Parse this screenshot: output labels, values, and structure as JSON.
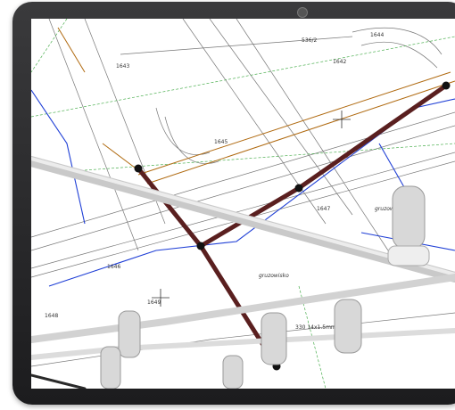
{
  "device": {
    "camera_icon": "webcam-dot-icon"
  },
  "map": {
    "parcel_labels": [
      "536/2",
      "1642",
      "1643",
      "1644",
      "1645",
      "1646",
      "1647",
      "1648",
      "1649"
    ],
    "annotation_labels": [
      "gruzowisko",
      "gruzowisko"
    ],
    "cable_label": "330 14x1.5mm napow.",
    "colors": {
      "power_line": "#5a1f1f",
      "survey_lines": "#4a4a4a",
      "water_lines": "#1f3fd6",
      "gas_lines": "#b06a10",
      "green_boundary": "#4caf50"
    }
  }
}
